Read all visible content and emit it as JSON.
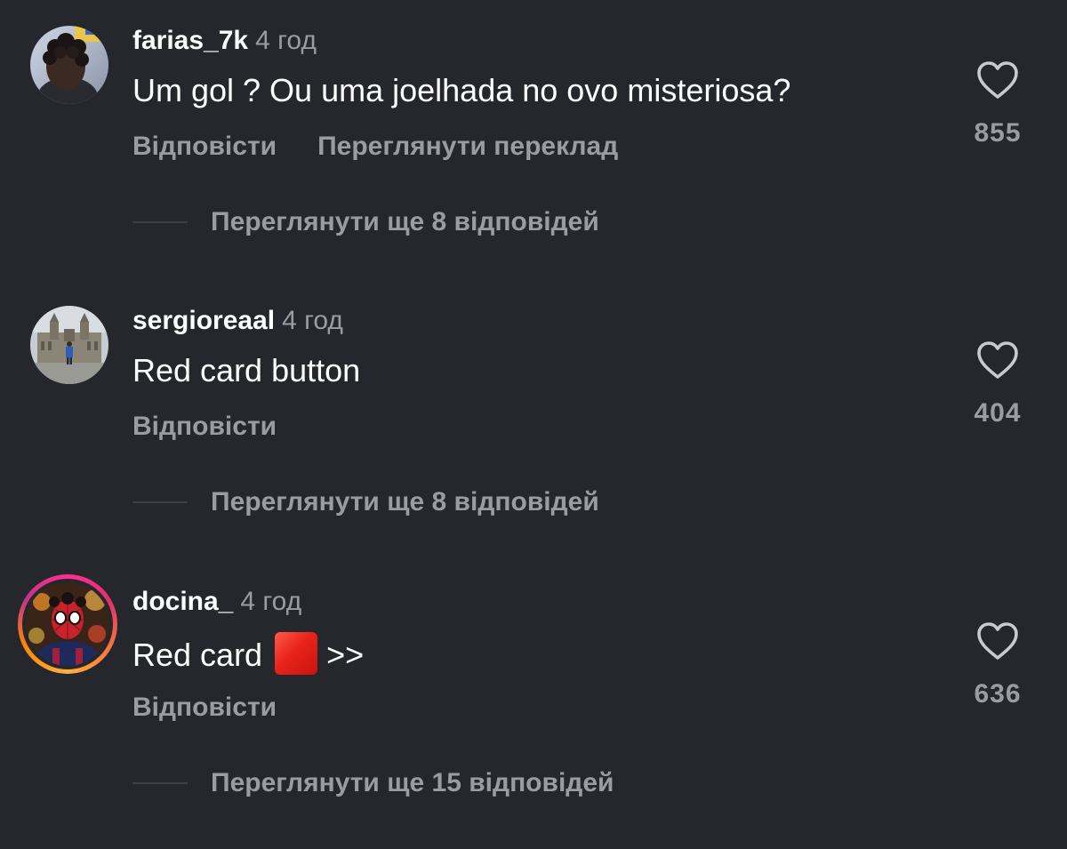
{
  "comments": [
    {
      "username": "farias_7k",
      "time": "4 год",
      "text": "Um gol ? Ou uma joelhada no ovo misteriosa?",
      "reply_label": "Відповісти",
      "translate_label": "Переглянути переклад",
      "likes": "855",
      "view_replies": "Переглянути ще 8 відповідей",
      "avatar": "avatar-curly-hair"
    },
    {
      "username": "sergioreaal",
      "time": "4 год",
      "text": "Red card button",
      "reply_label": "Відповісти",
      "likes": "404",
      "view_replies": "Переглянути ще 8 відповідей",
      "avatar": "avatar-cathedral"
    },
    {
      "username": "docina_",
      "time": "4 год",
      "text_before": "Red card",
      "text_emoji": "red-square-emoji",
      "text_after": ">>",
      "reply_label": "Відповісти",
      "likes": "636",
      "view_replies": "Переглянути ще 15 відповідей",
      "avatar": "avatar-spiderman-story"
    }
  ],
  "icons": {
    "like": "heart-outline-icon"
  },
  "colors": {
    "background": "#25272c",
    "primary_text": "#ffffff",
    "secondary_text": "#9b9ca1"
  }
}
